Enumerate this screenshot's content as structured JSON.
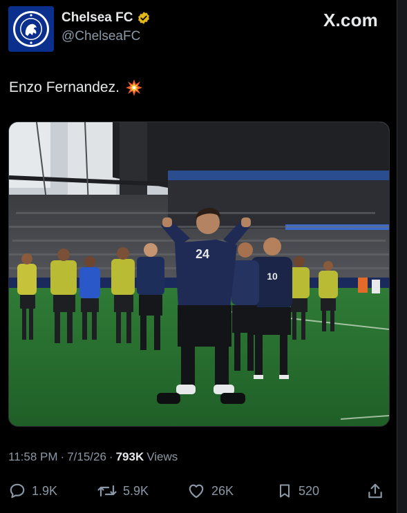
{
  "header": {
    "display_name": "Chelsea FC",
    "handle": "@ChelseaFC",
    "brand": "X.com"
  },
  "tweet": {
    "text": "Enzo Fernandez.",
    "emoji_icon": "collision-burst-icon"
  },
  "media": {
    "jersey_main": "24",
    "jersey_left_player": "10"
  },
  "meta": {
    "time": "11:58 PM",
    "separator": "·",
    "date": "7/15/26",
    "views_count": "793K",
    "views_label": "Views"
  },
  "actions": {
    "replies": "1.9K",
    "reposts": "5.9K",
    "likes": "26K",
    "bookmarks": "520"
  },
  "colors": {
    "background": "#000000",
    "text": "#e7e9ea",
    "muted": "#8b98a5",
    "verified_gold": "#e2b719",
    "chelsea_blue": "#0b2f8c"
  }
}
